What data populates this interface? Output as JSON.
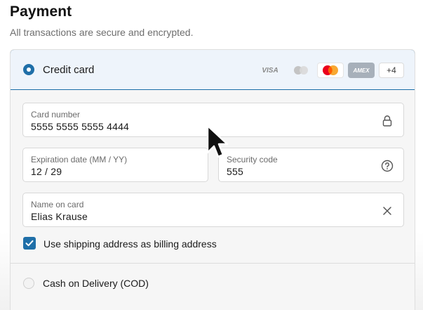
{
  "header": {
    "title": "Payment",
    "subtitle": "All transactions are secure and encrypted."
  },
  "credit_card": {
    "label": "Credit card",
    "selected": true,
    "brands": [
      {
        "name": "VISA",
        "icon": "visa-icon"
      },
      {
        "name": "Generic card",
        "icon": "generic-card-icon"
      },
      {
        "name": "Mastercard",
        "icon": "mastercard-icon"
      },
      {
        "name": "AMEX",
        "icon": "amex-icon"
      }
    ],
    "more_brands": "+4"
  },
  "fields": {
    "card_number": {
      "label": "Card number",
      "value": "5555 5555 5555 4444",
      "icon": "lock-icon"
    },
    "expiration": {
      "label": "Expiration date (MM / YY)",
      "value": "12 / 29"
    },
    "security_code": {
      "label": "Security code",
      "value": "555",
      "icon": "help-circle-icon"
    },
    "name_on_card": {
      "label": "Name on card",
      "value": "Elias Krause",
      "icon": "clear-icon"
    }
  },
  "billing": {
    "label": "Use shipping address as billing address",
    "checked": true
  },
  "cod": {
    "label": "Cash on Delivery (COD)",
    "selected": false
  },
  "colors": {
    "accent": "#1f6fa8",
    "selected_bg": "#eef4fb"
  }
}
